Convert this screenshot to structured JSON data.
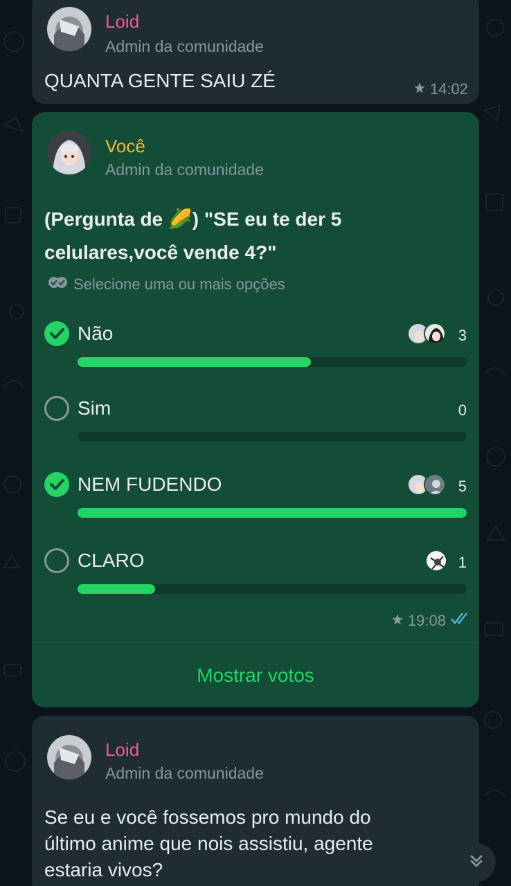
{
  "colors": {
    "background": "#0b141a",
    "incoming_bubble": "#1f2c33",
    "outgoing_bubble": "#144d37",
    "accent": "#25d366",
    "loid_name": "#f15c8b",
    "you_name": "#f2b83c",
    "read_ticks": "#53bdeb"
  },
  "messages": [
    {
      "sender": "Loid",
      "role": "Admin da comunidade",
      "text": "QUANTA GENTE SAIU ZÉ",
      "time": "14:02",
      "starred": true
    },
    {
      "sender": "Você",
      "role": "Admin da comunidade",
      "poll": {
        "question_line1": "(Pergunta de 🌽) \"SE eu te der 5",
        "question_line2": "celulares,você vende 4?\"",
        "hint": "Selecione uma ou mais opções",
        "options": [
          {
            "label": "Não",
            "count": "3",
            "checked": true,
            "fraction": 0.6
          },
          {
            "label": "Sim",
            "count": "0",
            "checked": false,
            "fraction": 0.0
          },
          {
            "label": "NEM FUDENDO",
            "count": "5",
            "checked": true,
            "fraction": 1.0
          },
          {
            "label": "CLARO",
            "count": "1",
            "checked": false,
            "fraction": 0.2
          }
        ],
        "show_votes": "Mostrar votos"
      },
      "time": "19:08",
      "starred": true,
      "read": true
    },
    {
      "sender": "Loid",
      "role": "Admin da comunidade",
      "text_line1": "Se eu e você fossemos pro mundo do",
      "text_line2": "último anime que nois assistiu, agente",
      "text_line3": "estaria vivos?"
    }
  ],
  "icons": {
    "star": "star-icon",
    "double_check": "double-check-icon",
    "multi_select": "multi-select-icon",
    "scroll_down": "chevron-double-down-icon"
  }
}
